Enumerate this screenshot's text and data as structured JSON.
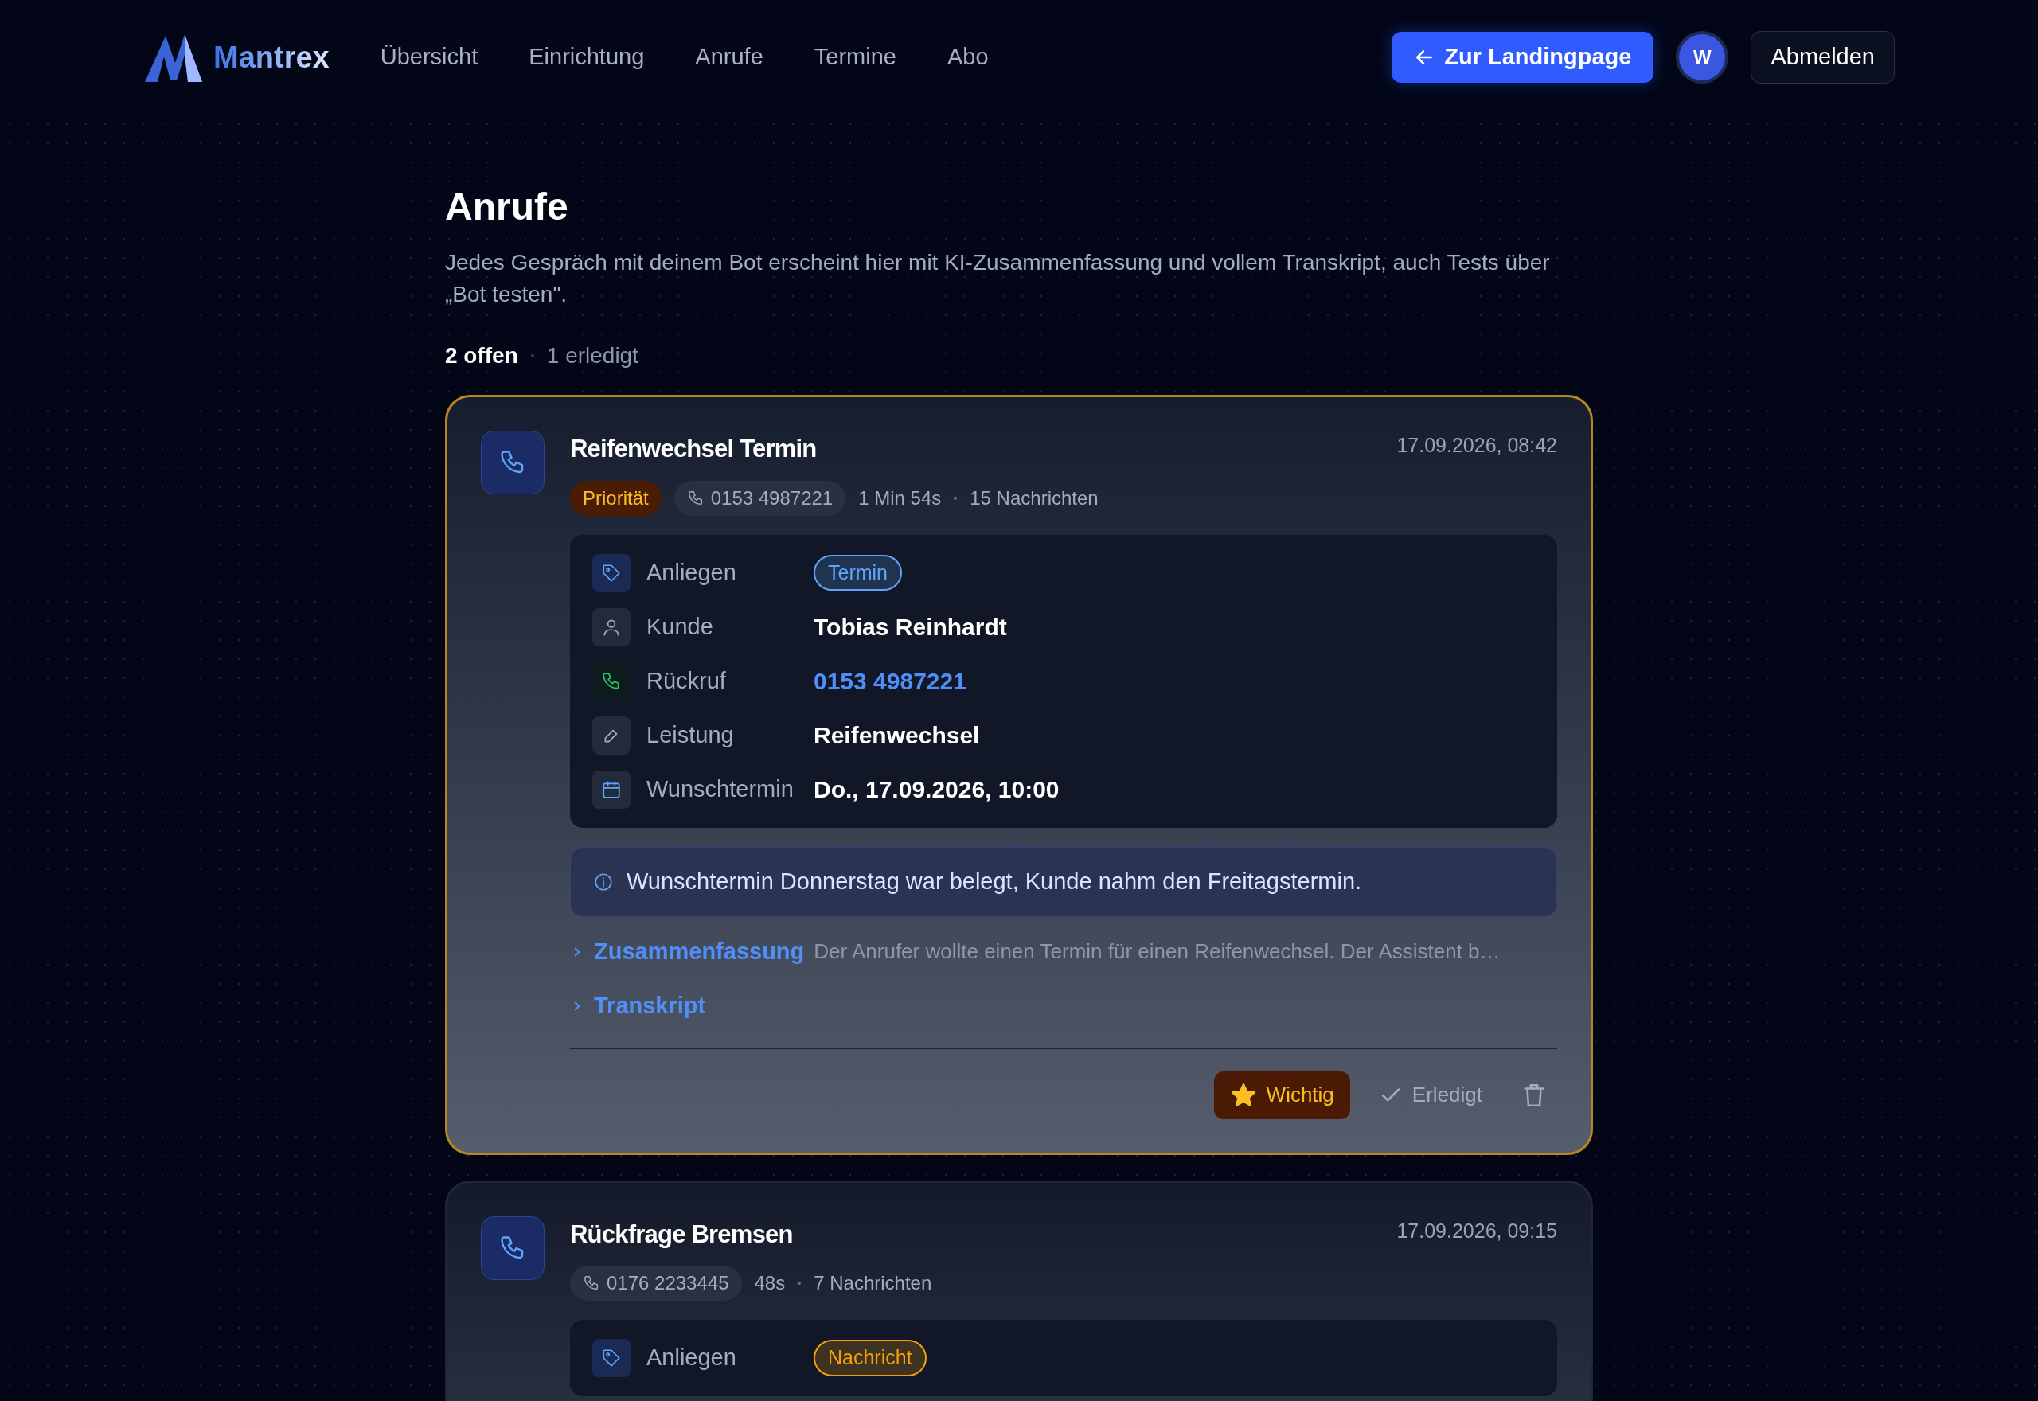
{
  "brand": "Mantrex",
  "nav": [
    "Übersicht",
    "Einrichtung",
    "Anrufe",
    "Termine",
    "Abo"
  ],
  "landing_button": "Zur Landingpage",
  "avatar": "W",
  "logout": "Abmelden",
  "page": {
    "title": "Anrufe",
    "description": "Jedes Gespräch mit deinem Bot erscheint hier mit KI-Zusammenfassung und vollem Transkript, auch Tests über „Bot testen\"."
  },
  "filters": [
    {
      "label": "2 offen",
      "selected": true
    },
    {
      "label": "1 erledigt",
      "selected": false
    }
  ],
  "calls": [
    {
      "title": "Reifenwechsel Termin",
      "time": "17.09.2026, 08:42",
      "important": true,
      "badge": "Priorität",
      "phone": "0153 4987221",
      "duration": "1 Min 54s",
      "messages": "15 Nachrichten",
      "details": [
        {
          "label": "Anliegen",
          "kind": "tag",
          "value": "Termin",
          "color": "#60a5fa"
        },
        {
          "label": "Kunde",
          "kind": "text",
          "value": "Tobias Reinhardt"
        },
        {
          "label": "Rückruf",
          "kind": "link",
          "value": "0153 4987221"
        },
        {
          "label": "Leistung",
          "kind": "text",
          "value": "Reifenwechsel"
        },
        {
          "label": "Wunschtermin",
          "kind": "text",
          "value": "Do., 17.09.2026, 10:00"
        }
      ],
      "note": "Wunschtermin Donnerstag war belegt, Kunde nahm den Freitagstermin.",
      "summary_label": "Zusammenfassung",
      "summary": "Der Anrufer wollte einen Termin für einen Reifenwechsel. Der Assistent b…",
      "transcript_label": "Transkript",
      "actions": {
        "important": "Wichtig",
        "done": "Erledigt"
      }
    },
    {
      "title": "Rückfrage Bremsen",
      "time": "17.09.2026, 09:15",
      "important": false,
      "phone": "0176 2233445",
      "duration": "48s",
      "messages": "7 Nachrichten",
      "details": [
        {
          "label": "Anliegen",
          "kind": "tag",
          "value": "Nachricht",
          "color": "#f59e0b"
        }
      ]
    }
  ]
}
